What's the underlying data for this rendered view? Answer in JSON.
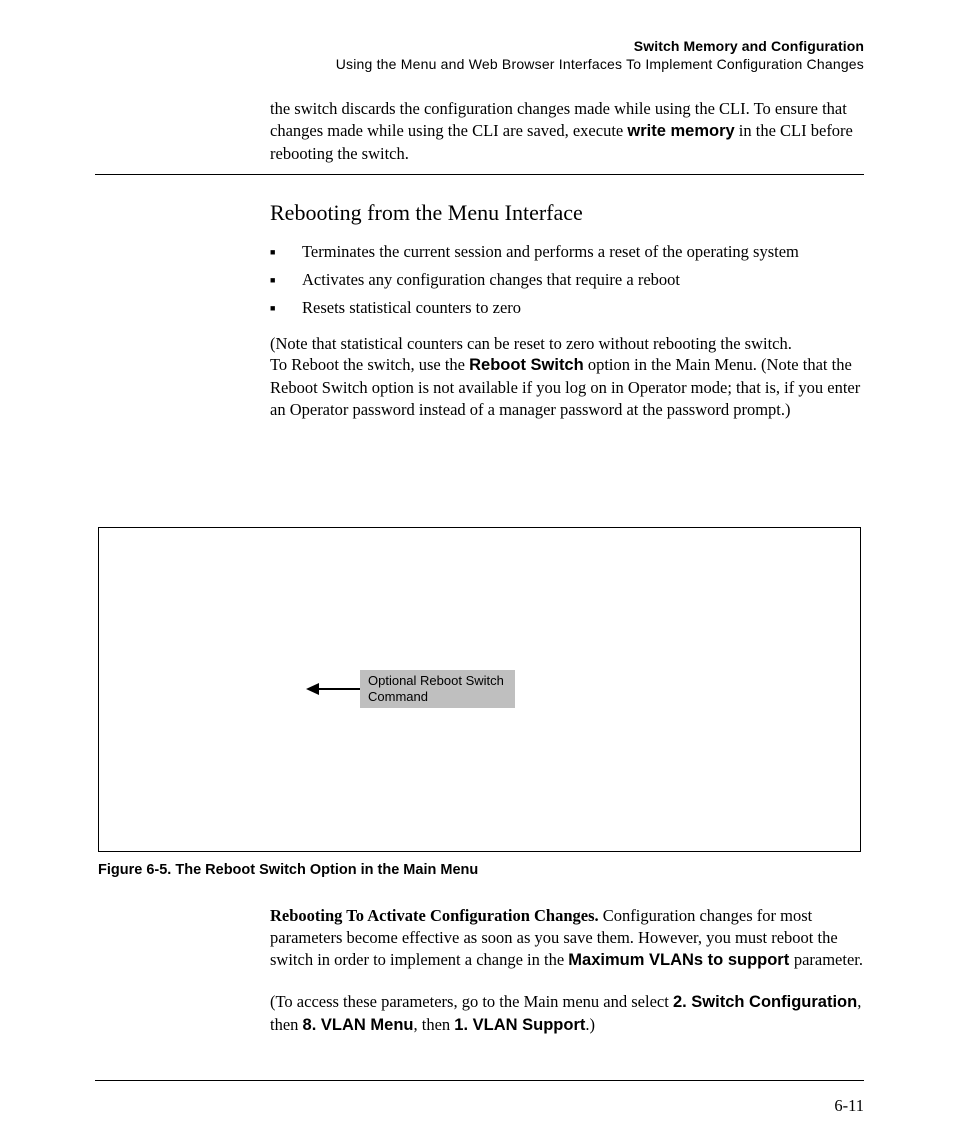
{
  "header": {
    "line1": "Switch Memory and Configuration",
    "line2": "Using the Menu and Web Browser Interfaces To Implement Configuration Changes"
  },
  "intro": {
    "p1_a": "the switch discards the configuration changes made while using the CLI. To ensure that changes made while using the CLI are saved, execute ",
    "p1_bold": "write memory",
    "p1_b": " in the CLI before rebooting the switch."
  },
  "section": {
    "title": "Rebooting from the Menu Interface",
    "bullets": [
      "Terminates the current session and performs a reset of the operating system",
      "Activates any configuration changes that require a reboot",
      "Resets statistical counters to zero"
    ],
    "note": "(Note that statistical counters can be reset to zero without rebooting the switch.",
    "reboot_a": "To Reboot the switch, use the ",
    "reboot_bold": "Reboot Switch",
    "reboot_b": " option in the Main Menu. (Note that the Reboot Switch option is not available if you log on in Operator mode; that is, if you enter an Operator password instead of a manager password at the password prompt.)"
  },
  "figure": {
    "callout": "Optional Reboot Switch Command",
    "caption": "Figure 6-5.    The Reboot Switch Option in the Main Menu"
  },
  "after": {
    "runin": "Rebooting To Activate Configuration Changes.  ",
    "a1": "Configuration changes for most parameters become effective as soon as you save them. However, you must reboot the switch in order to implement a change in the ",
    "a1_bold": "Maximum VLANs to support ",
    "a1_tail": "parameter.",
    "b_pre": "(To access these parameters, go to the Main menu and select ",
    "b1": "2. Switch Configuration",
    "b_mid1": ", then ",
    "b2": "8. VLAN Menu",
    "b_mid2": ", then ",
    "b3": "1. VLAN Support",
    "b_end": ".)"
  },
  "pagenum": "6-11"
}
